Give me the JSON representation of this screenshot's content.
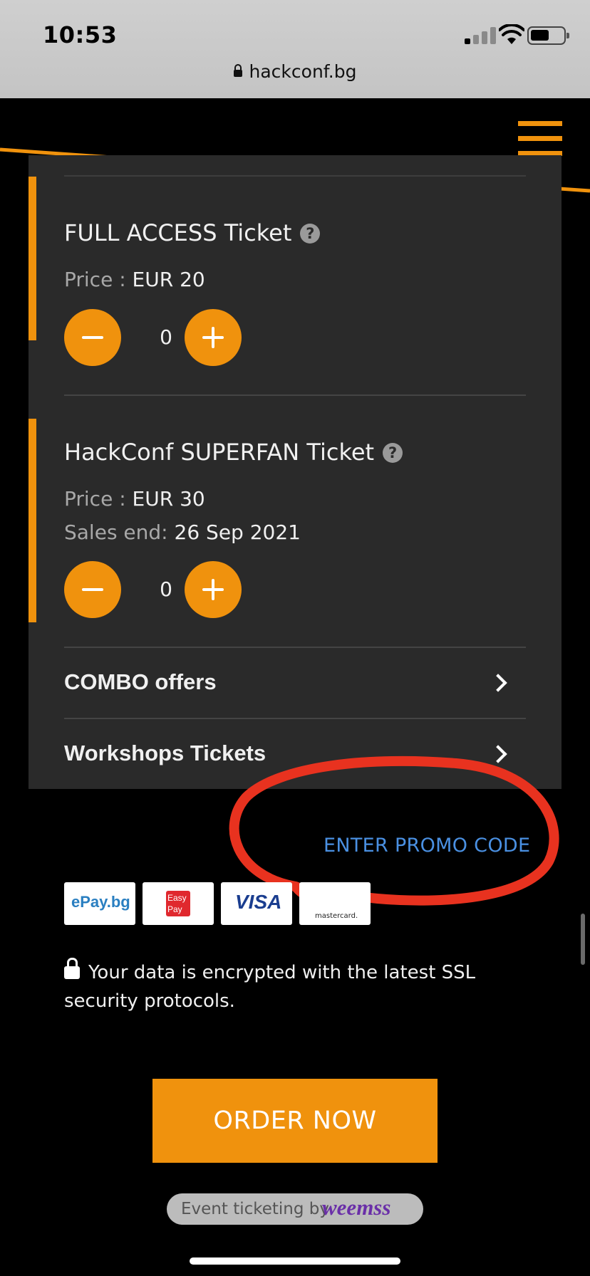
{
  "status_bar": {
    "time": "10:53"
  },
  "browser": {
    "url": "hackconf.bg"
  },
  "tickets": [
    {
      "title": "FULL ACCESS Ticket",
      "price_label": "Price :",
      "price_value": "EUR 20",
      "quantity": "0"
    },
    {
      "title": "HackConf SUPERFAN Ticket",
      "price_label": "Price :",
      "price_value": "EUR 30",
      "sales_end_label": "Sales end:",
      "sales_end_value": "26 Sep 2021",
      "quantity": "0"
    }
  ],
  "sections": [
    {
      "label": "COMBO offers"
    },
    {
      "label": "Workshops Tickets"
    }
  ],
  "promo": {
    "label": "ENTER PROMO CODE"
  },
  "payment_logos": {
    "epay": "ePay.bg",
    "easypay_line1": "Easy",
    "easypay_line2": "Pay",
    "visa": "VISA",
    "mastercard": "mastercard."
  },
  "security_note": "Your data is encrypted with the latest SSL security protocols.",
  "order_button": {
    "label": "ORDER NOW"
  },
  "footer": {
    "powered_text": "Event ticketing by",
    "brand": "weemss"
  },
  "colors": {
    "accent": "#f0920d",
    "card": "#2a2a2a",
    "link": "#4a90e2",
    "annotation": "#e8321f"
  },
  "icons": [
    "lock-icon",
    "signal-icon",
    "wifi-icon",
    "battery-icon",
    "menu-icon",
    "help-icon",
    "minus-icon",
    "plus-icon",
    "chevron-right-icon"
  ]
}
